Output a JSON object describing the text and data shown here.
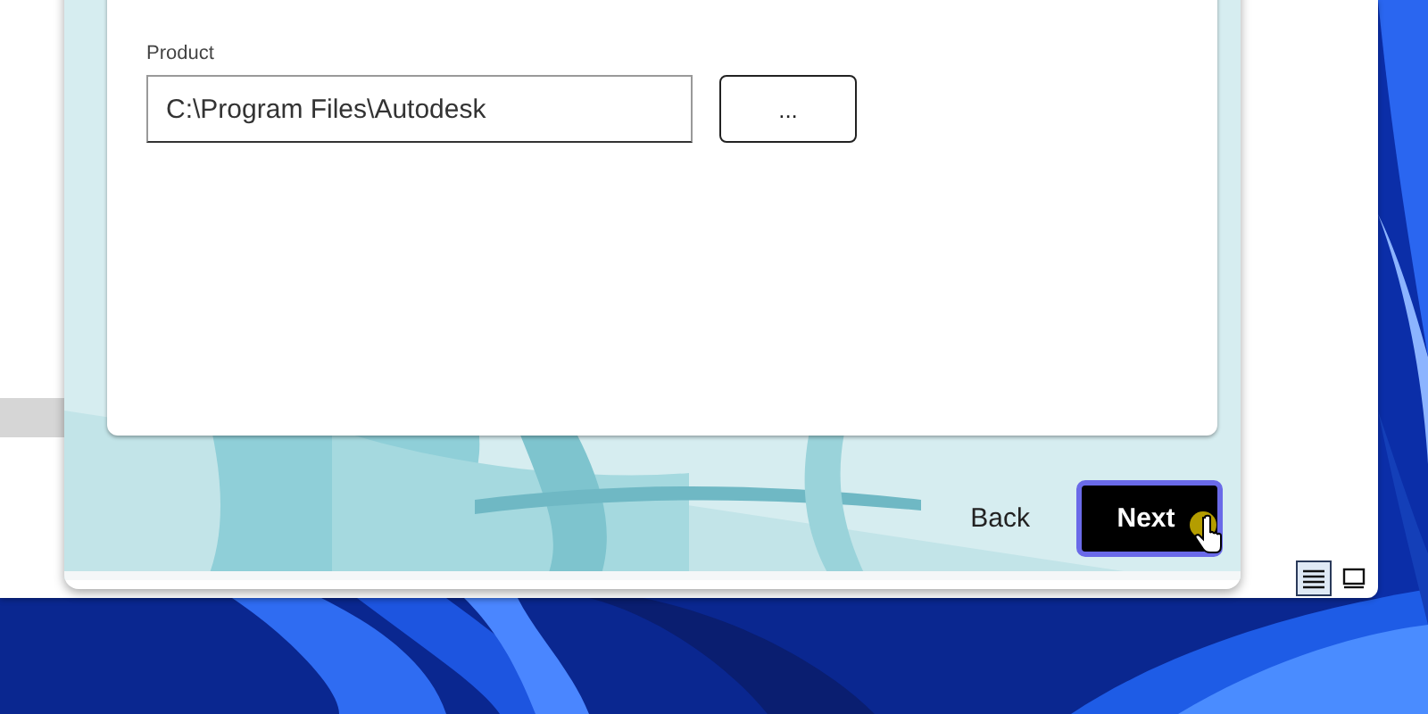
{
  "installer": {
    "location": {
      "label": "Product",
      "value": "C:\\Program Files\\Autodesk"
    },
    "browse_button": "...",
    "back_button": "Back",
    "next_button": {
      "label": "Next",
      "focused": true
    }
  },
  "explorer": {
    "view_buttons": [
      {
        "kind": "details",
        "selected": true
      },
      {
        "kind": "thumbnails",
        "selected": false
      }
    ]
  }
}
